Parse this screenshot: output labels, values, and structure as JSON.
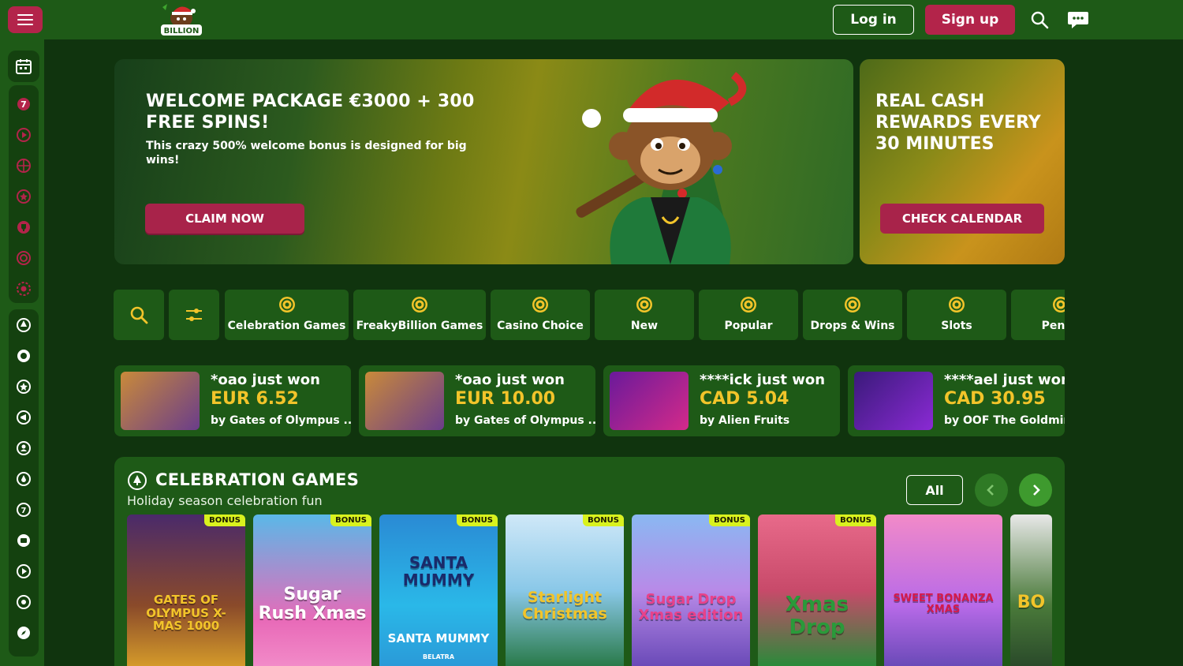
{
  "header": {
    "menu_icon": "hamburger-icon",
    "logo_alt": "Freaky Billion",
    "login_label": "Log in",
    "signup_label": "Sign up",
    "search_icon": "search-icon",
    "chat_icon": "chat-icon"
  },
  "colors": {
    "accent": "#b3244a",
    "panel": "#1e5a17",
    "background": "#10340e",
    "amount": "#f2c42a",
    "bonus_badge": "#d9f21e"
  },
  "sidebar": {
    "items": [
      "calendar-icon",
      "seven-icon",
      "play-icon",
      "ball-icon",
      "star-icon",
      "trophy-icon",
      "target-icon",
      "gear-icon",
      "tree-icon",
      "coin-icon",
      "star-icon",
      "megaphone-icon",
      "user-icon",
      "drop-icon",
      "seven-icon",
      "dice-icon",
      "play-icon",
      "live-icon",
      "compass-icon"
    ]
  },
  "banners": {
    "welcome": {
      "title": "WELCOME PACKAGE €3000 + 300 FREE SPINS!",
      "subtitle": "This crazy 500% welcome bonus is designed for big wins!",
      "cta": "CLAIM NOW"
    },
    "rewards": {
      "title": "REAL CASH REWARDS EVERY 30 MINUTES",
      "cta": "CHECK CALENDAR"
    }
  },
  "categories": [
    {
      "label": "Celebration Games",
      "icon": "tree-icon"
    },
    {
      "label": "FreakyBillion Games",
      "icon": "coin-icon"
    },
    {
      "label": "Casino Choice",
      "icon": "star-icon"
    },
    {
      "label": "New",
      "icon": "megaphone-icon"
    },
    {
      "label": "Popular",
      "icon": "user-icon"
    },
    {
      "label": "Drops & Wins",
      "icon": "drop-icon"
    },
    {
      "label": "Slots",
      "icon": "seven-icon"
    },
    {
      "label": "Penny",
      "icon": "coin-icon"
    }
  ],
  "winners": [
    {
      "user": "*oao just won",
      "amount": "EUR 6.52",
      "game": "by Gates of Olympus ..."
    },
    {
      "user": "*oao just won",
      "amount": "EUR 10.00",
      "game": "by Gates of Olympus ..."
    },
    {
      "user": "****ick just won",
      "amount": "CAD 5.04",
      "game": "by Alien Fruits"
    },
    {
      "user": "****ael just won",
      "amount": "CAD 30.95",
      "game": "by OOF The Goldmin..."
    }
  ],
  "section": {
    "title": "CELEBRATION GAMES",
    "subtitle": "Holiday season celebration fun",
    "all_label": "All"
  },
  "games": [
    {
      "title": "GATES OF OLYMPUS X-MAS 1000",
      "badge": "BONUS"
    },
    {
      "title": "Sugar Rush Xmas",
      "badge": "BONUS"
    },
    {
      "title": "SANTA MUMMY",
      "badge": "BONUS",
      "caption": "SANTA MUMMY",
      "provider": "BELATRA"
    },
    {
      "title": "Starlight Christmas",
      "badge": "BONUS"
    },
    {
      "title": "Sugar Drop Xmas edition",
      "badge": "BONUS"
    },
    {
      "title": "Xmas Drop",
      "badge": "BONUS"
    },
    {
      "title": "SWEET BONANZA XMAS",
      "badge": ""
    },
    {
      "title": "BO",
      "badge": ""
    }
  ]
}
